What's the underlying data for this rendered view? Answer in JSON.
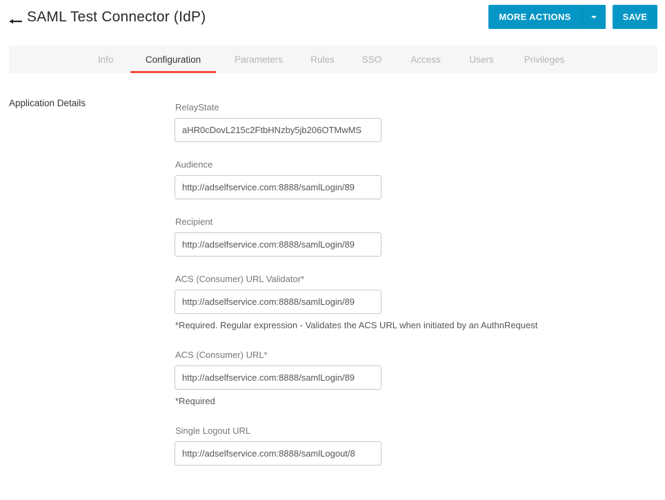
{
  "header": {
    "back_icon": "arrow-left-icon",
    "title": "SAML Test Connector (IdP)",
    "more_actions_label": "MORE ACTIONS",
    "more_actions_caret_icon": "caret-down-icon",
    "save_label": "SAVE",
    "accent_color": "#0596c5"
  },
  "tabs": {
    "active": "Configuration",
    "active_underline_color": "#f4483d",
    "items": [
      {
        "label": "Info"
      },
      {
        "label": "Configuration"
      },
      {
        "label": "Parameters"
      },
      {
        "label": "Rules"
      },
      {
        "label": "SSO"
      },
      {
        "label": "Access"
      },
      {
        "label": "Users"
      },
      {
        "label": "Privileges"
      }
    ]
  },
  "section": {
    "title": "Application Details"
  },
  "fields": [
    {
      "label": "RelayState",
      "value": "aHR0cDovL215c2FtbHNzby5jb206OTMwMS",
      "help": ""
    },
    {
      "label": "Audience",
      "value": "http://adselfservice.com:8888/samlLogin/89",
      "help": ""
    },
    {
      "label": "Recipient",
      "value": "http://adselfservice.com:8888/samlLogin/89",
      "help": ""
    },
    {
      "label": "ACS (Consumer) URL Validator*",
      "value": "http://adselfservice.com:8888/samlLogin/89",
      "help": "*Required. Regular expression - Validates the ACS URL when initiated by an AuthnRequest"
    },
    {
      "label": "ACS (Consumer) URL*",
      "value": "http://adselfservice.com:8888/samlLogin/89",
      "help": "*Required"
    },
    {
      "label": "Single Logout URL",
      "value": "http://adselfservice.com:8888/samlLogout/8",
      "help": ""
    }
  ]
}
